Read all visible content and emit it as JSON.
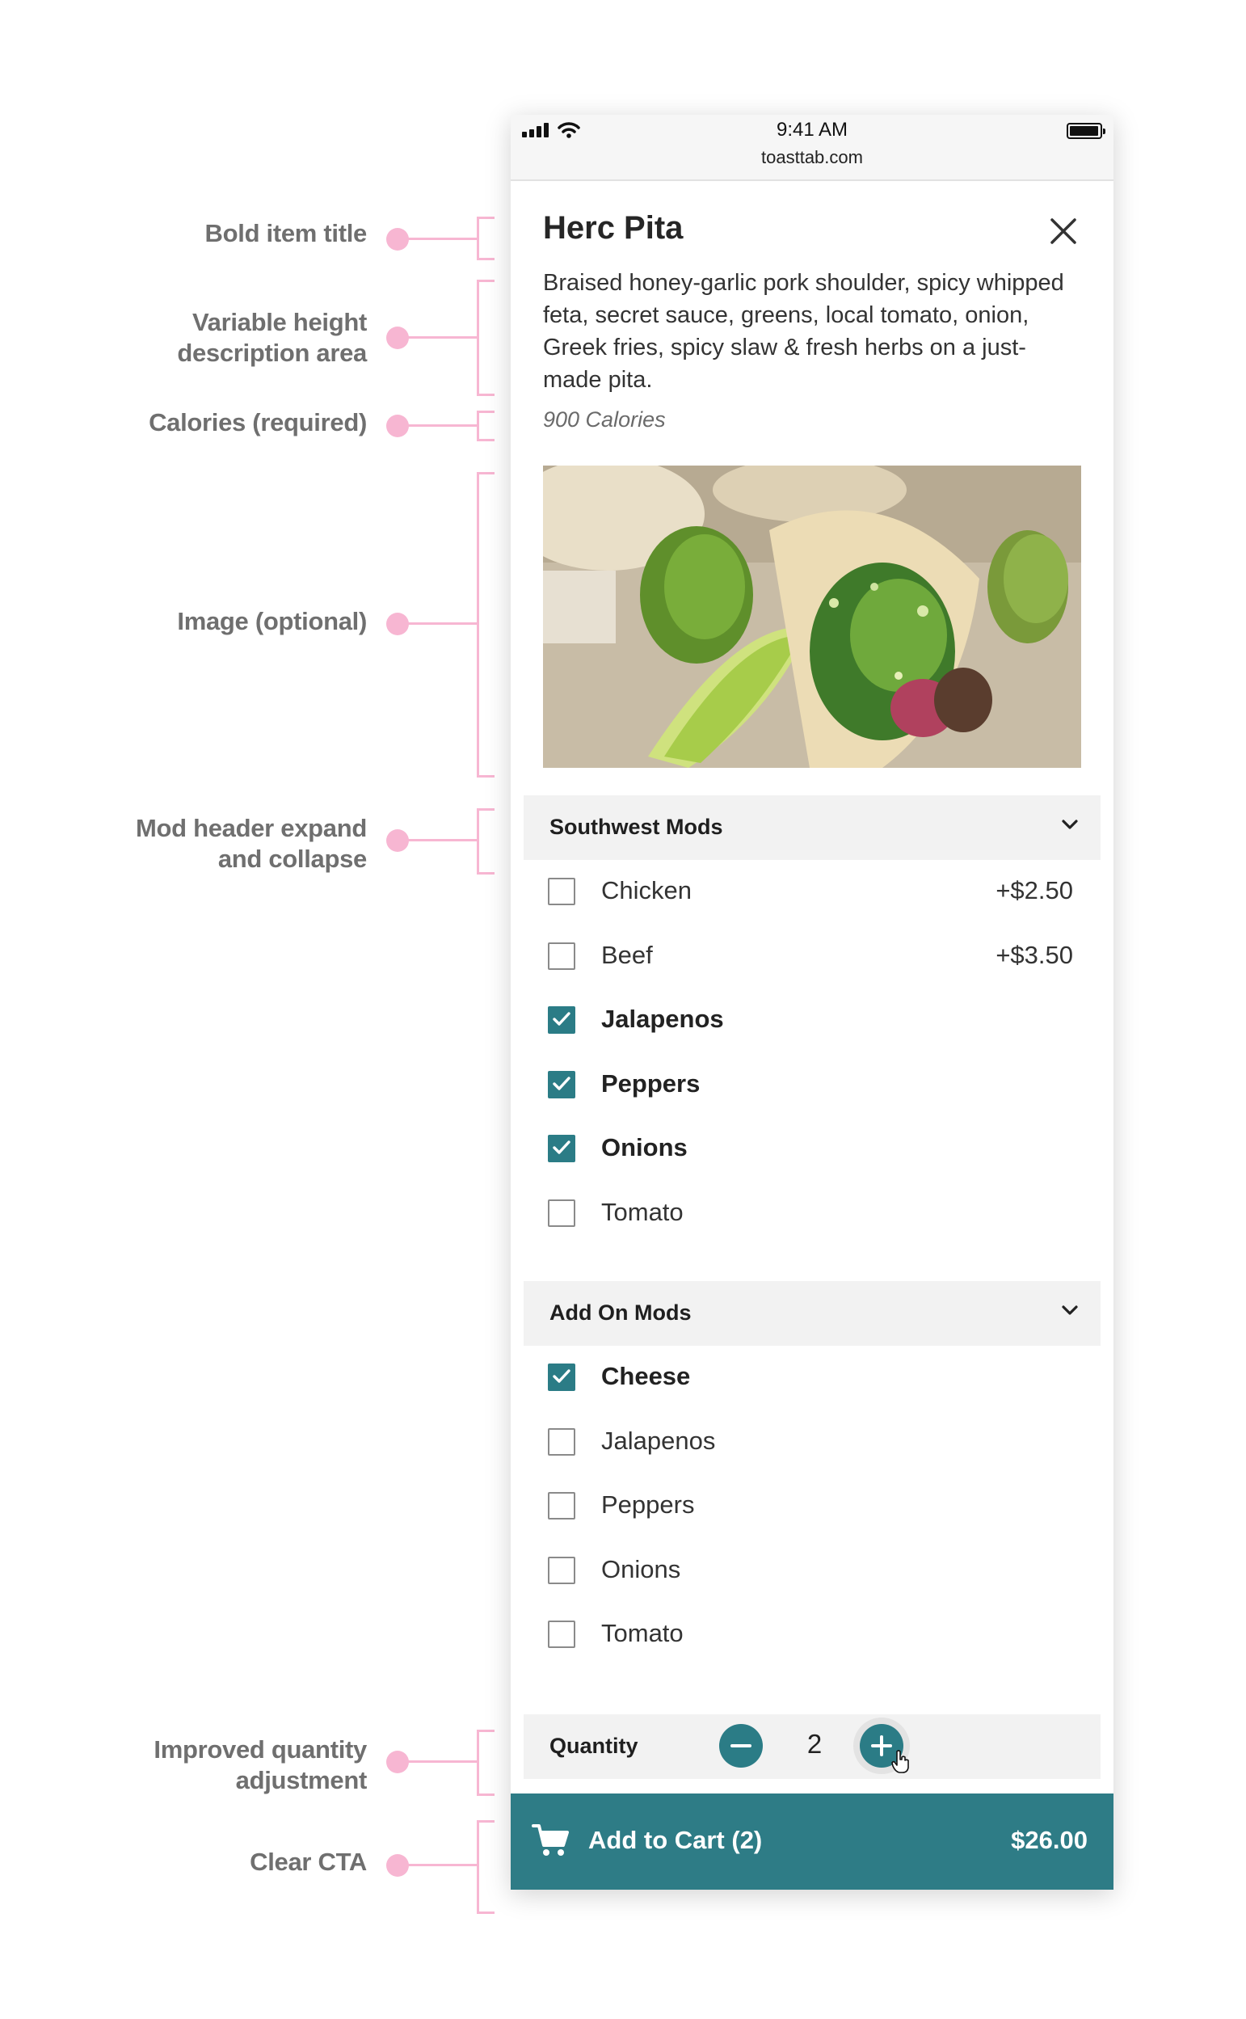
{
  "annotations": [
    {
      "label": "Bold item title"
    },
    {
      "label": "Variable height\ndescription area"
    },
    {
      "label": "Calories (required)"
    },
    {
      "label": "Image (optional)"
    },
    {
      "label": "Mod header expand\nand collapse"
    },
    {
      "label": "Improved quantity\nadjustment"
    },
    {
      "label": "Clear CTA"
    }
  ],
  "status_bar": {
    "time": "9:41 AM",
    "url": "toasttab.com"
  },
  "item": {
    "title": "Herc Pita",
    "description": "Braised honey-garlic pork shoulder, spicy whipped feta, secret sauce, greens, local tomato, onion, Greek fries, spicy slaw & fresh herbs on a just-made pita.",
    "calories": "900 Calories"
  },
  "mod_groups": [
    {
      "header": "Southwest Mods",
      "items": [
        {
          "label": "Chicken",
          "price": "+$2.50",
          "checked": false
        },
        {
          "label": "Beef",
          "price": "+$3.50",
          "checked": false
        },
        {
          "label": "Jalapenos",
          "price": "",
          "checked": true
        },
        {
          "label": "Peppers",
          "price": "",
          "checked": true
        },
        {
          "label": "Onions",
          "price": "",
          "checked": true
        },
        {
          "label": "Tomato",
          "price": "",
          "checked": false
        }
      ]
    },
    {
      "header": "Add On Mods",
      "items": [
        {
          "label": "Cheese",
          "price": "",
          "checked": true
        },
        {
          "label": "Jalapenos",
          "price": "",
          "checked": false
        },
        {
          "label": "Peppers",
          "price": "",
          "checked": false
        },
        {
          "label": "Onions",
          "price": "",
          "checked": false
        },
        {
          "label": "Tomato",
          "price": "",
          "checked": false
        }
      ]
    }
  ],
  "quantity": {
    "label": "Quantity",
    "value": "2"
  },
  "cta": {
    "label": "Add to Cart (2)",
    "price": "$26.00"
  },
  "colors": {
    "accent": "#2e7c86",
    "annotation": "#f7b6d2",
    "header_bg": "#f2f2f2"
  },
  "icons": [
    "signal-icon",
    "wifi-icon",
    "battery-icon",
    "close-icon",
    "chevron-down-icon",
    "checkmark-icon",
    "minus-icon",
    "plus-icon",
    "hand-cursor-icon",
    "cart-icon"
  ]
}
